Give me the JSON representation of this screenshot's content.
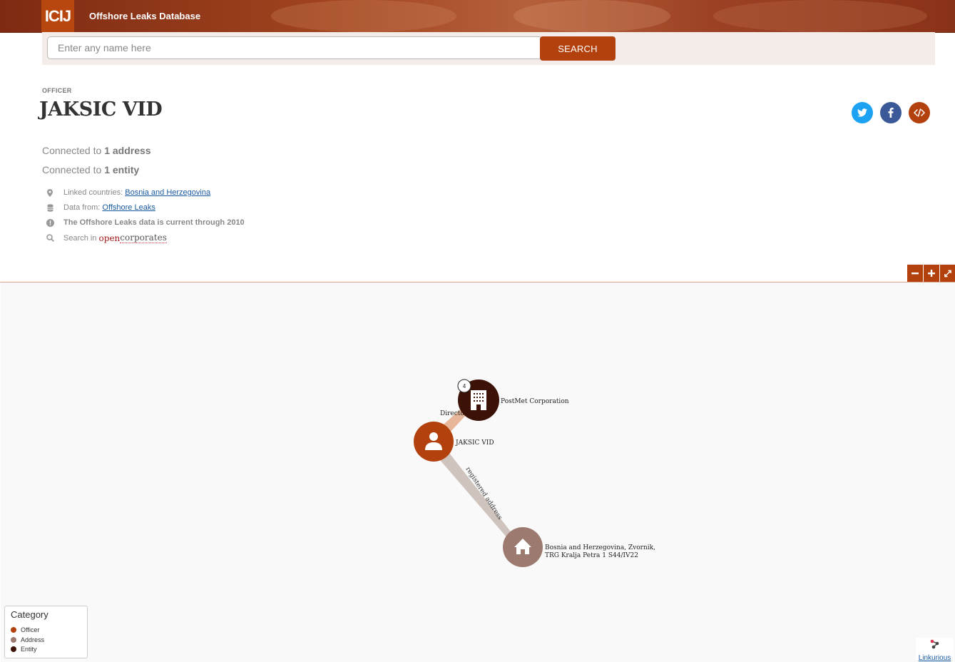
{
  "header": {
    "logo_text": "ICIJ",
    "site_title": "Offshore Leaks Database",
    "brand_color": "#b3410d"
  },
  "search": {
    "placeholder": "Enter any name here",
    "button_label": "SEARCH"
  },
  "node": {
    "type_label": "OFFICER",
    "name": "JAKSIC VID"
  },
  "share": {
    "icons": [
      "twitter-icon",
      "facebook-icon",
      "embed-code-icon"
    ],
    "colors": [
      "#1da1f2",
      "#3b5998",
      "#b3410d"
    ]
  },
  "connections": {
    "address_prefix": "Connected to",
    "address_count": "1 address",
    "entity_prefix": "Connected to",
    "entity_count": "1 entity"
  },
  "meta": {
    "countries_label": "Linked countries:",
    "countries_value": "Bosnia and Herzegovina",
    "data_from_label": "Data from:",
    "data_from_value": "Offshore Leaks",
    "current_through": "The Offshore Leaks data is current through 2010",
    "search_in_label": "Search in",
    "opencorporates_open": "open",
    "opencorporates_corp": "corporates"
  },
  "graph": {
    "controls": [
      "zoom-out",
      "zoom-in",
      "fullscreen"
    ],
    "nodes": {
      "officer": {
        "label": "JAKSIC VID",
        "color": "#b3410d"
      },
      "entity": {
        "label": "PostMet Corporation",
        "badge": "4",
        "color": "#3d1206"
      },
      "address": {
        "label_line1": "Bosnia and Herzegovina, Zvornik,",
        "label_line2": "TRG Kralja Petra 1 S44/IV22",
        "color": "#9c7a6f"
      }
    },
    "edges": {
      "officer_entity": "Director",
      "officer_address": "registered address"
    }
  },
  "legend": {
    "title": "Category",
    "items": [
      {
        "label": "Officer",
        "color": "#b3410d"
      },
      {
        "label": "Address",
        "color": "#9c7a6f"
      },
      {
        "label": "Entity",
        "color": "#3d1206"
      }
    ]
  },
  "attribution": {
    "label": "Linkurious"
  }
}
